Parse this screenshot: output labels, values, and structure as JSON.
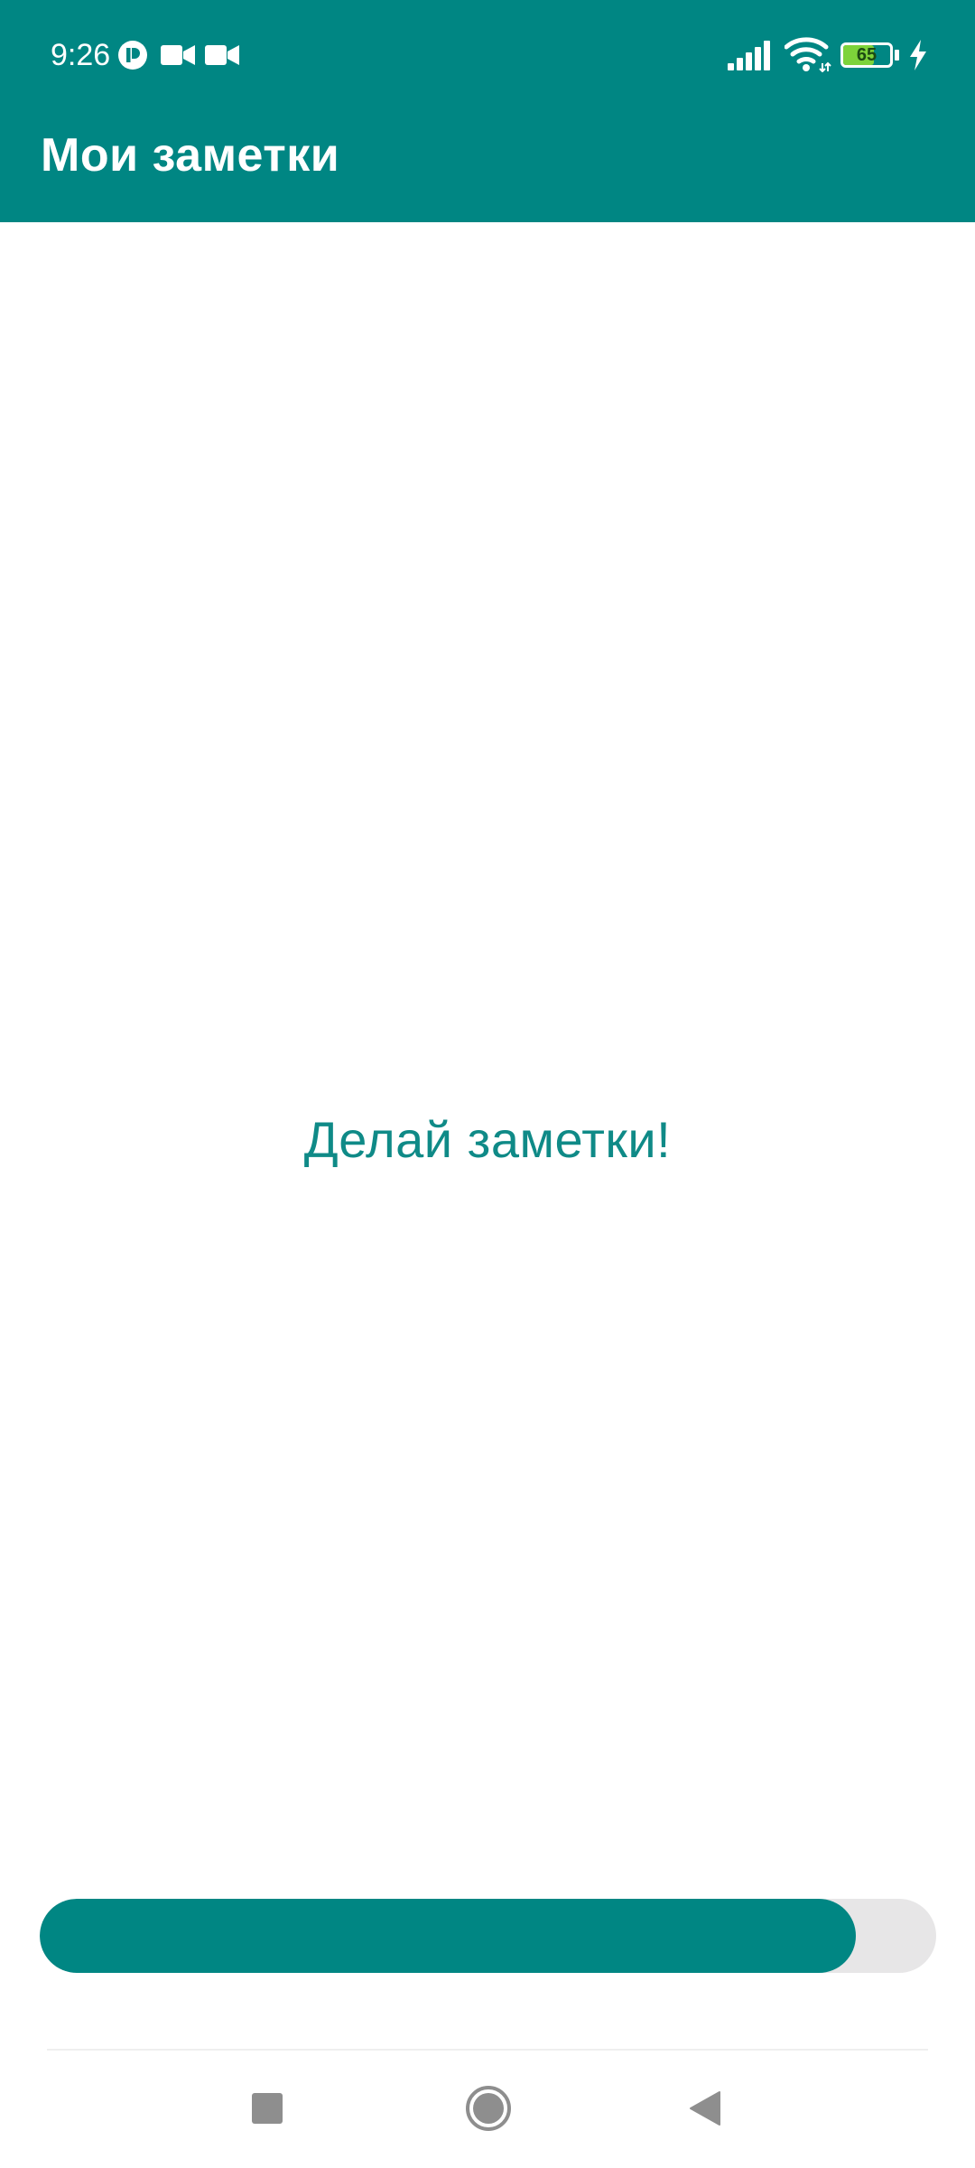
{
  "status_bar": {
    "time": "9:26",
    "battery_level": "65",
    "battery_fraction": 0.65,
    "battery_fill_color": "#7dd33a",
    "charging": true,
    "notification_icons": [
      "p-app-icon",
      "video-camera-icon",
      "video-camera-icon"
    ],
    "system_icons": [
      "signal-icon",
      "wifi-icon",
      "battery-icon",
      "charging-bolt-icon"
    ]
  },
  "app_bar": {
    "title": "Мои заметки",
    "background_color": "#008683",
    "title_color": "#ffffff"
  },
  "main": {
    "empty_state_text": "Делай заметки!",
    "text_color": "#0f8a87"
  },
  "progress": {
    "fraction": 0.91,
    "fill_color": "#008683",
    "track_color": "#e7e6e7"
  },
  "nav_bar": {
    "buttons": [
      "recents-icon",
      "home-icon",
      "back-icon"
    ],
    "icon_color": "#8e8e8e"
  }
}
